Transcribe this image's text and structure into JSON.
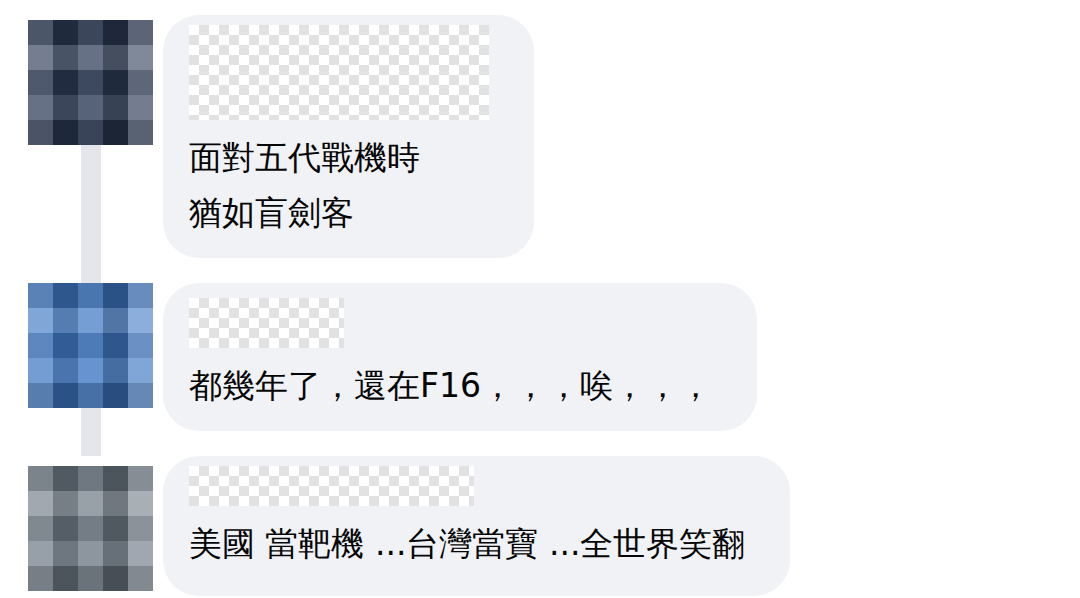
{
  "comments": [
    {
      "name_redacted": true,
      "color": "#2b3a55",
      "lines": [
        "面對五代戰機時",
        "猶如盲劍客"
      ]
    },
    {
      "name_redacted": true,
      "color": "#3f78c4",
      "lines": [
        "都幾年了，還在F16，，，唉，，，"
      ]
    },
    {
      "name_redacted": true,
      "color": "#6f7a86",
      "lines": [
        "美國 當靶機 ...台灣當寶 ...全世界笑翻"
      ]
    }
  ]
}
